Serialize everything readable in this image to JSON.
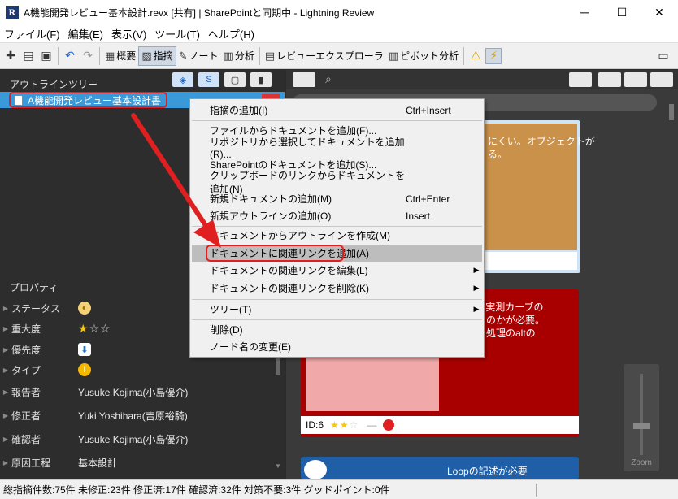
{
  "window": {
    "title": "A機能開発レビュー基本設計.revx [共有] | SharePointと同期中 - Lightning Review",
    "logo_letter": "R",
    "minimize": "─",
    "maximize": "☐",
    "close": "✕"
  },
  "menu": [
    "ファイル(F)",
    "編集(E)",
    "表示(V)",
    "ツール(T)",
    "ヘルプ(H)"
  ],
  "toolbar": {
    "overview": "概要",
    "findings": "指摘",
    "notes": "ノート",
    "analysis": "分析",
    "review_explorer": "レビューエクスプローラ",
    "pivot_analysis": "ピボット分析"
  },
  "outline": {
    "header": "アウトラインツリー",
    "root_node": "A機能開発レビュー基本設計書"
  },
  "properties": {
    "header": "プロパティ",
    "rows": [
      {
        "label": "ステータス",
        "value": ""
      },
      {
        "label": "重大度",
        "value": ""
      },
      {
        "label": "優先度",
        "value": ""
      },
      {
        "label": "タイプ",
        "value": ""
      },
      {
        "label": "報告者",
        "value": "Yusuke Kojima(小島優介)"
      },
      {
        "label": "修正者",
        "value": "Yuki Yoshihara(吉原裕騎)"
      },
      {
        "label": "確認者",
        "value": "Yusuke Kojima(小島優介)"
      },
      {
        "label": "原因工程",
        "value": "基本設計"
      }
    ],
    "severity_stars": {
      "filled": 1,
      "total": 3
    }
  },
  "context_menu": {
    "items": [
      {
        "label": "指摘の追加(I)",
        "shortcut": "Ctrl+Insert",
        "submenu": false
      },
      {
        "label": "ファイルからドキュメントを追加(F)...",
        "shortcut": "",
        "submenu": false
      },
      {
        "label": "リポジトリから選択してドキュメントを追加(R)...",
        "shortcut": "",
        "submenu": false
      },
      {
        "label": "SharePointのドキュメントを追加(S)...",
        "shortcut": "",
        "submenu": false
      },
      {
        "label": "クリップボードのリンクからドキュメントを追加(N)",
        "shortcut": "",
        "submenu": false
      },
      {
        "label": "新規ドキュメントの追加(M)",
        "shortcut": "Ctrl+Enter",
        "submenu": false
      },
      {
        "label": "新規アウトラインの追加(O)",
        "shortcut": "Insert",
        "submenu": false
      },
      {
        "label": "ドキュメントからアウトラインを作成(M)",
        "shortcut": "",
        "submenu": false
      },
      {
        "label": "ドキュメントに関連リンクを追加(A)",
        "shortcut": "",
        "submenu": false
      },
      {
        "label": "ドキュメントの関連リンクを編集(L)",
        "shortcut": "",
        "submenu": true
      },
      {
        "label": "ドキュメントの関連リンクを削除(K)",
        "shortcut": "",
        "submenu": true
      },
      {
        "label": "ツリー(T)",
        "shortcut": "",
        "submenu": true
      },
      {
        "label": "削除(D)",
        "shortcut": "",
        "submenu": false
      },
      {
        "label": "ノード名の変更(E)",
        "shortcut": "",
        "submenu": false
      }
    ],
    "submenu_glyph": "▶"
  },
  "cards": {
    "card1_text": "にくい。オブジェクトが\nる。",
    "card2_text": "カーブと実測カーブの\nどうするのかが必要。\nトを下の処理のaltの\nる",
    "card2_footer_id": "ID:6",
    "card3_text": "Loopの記述が必要"
  },
  "zoom_label": "Zoom",
  "statusbar": {
    "total": "総指摘件数:75件",
    "unfixed": "未修正:23件",
    "fixed": "修正済:17件",
    "confirmed": "確認済:32件",
    "na": "対策不要:3件",
    "goodpoint": "グッドポイント:0件"
  },
  "colors": {
    "selection_blue": "#3a9ad9",
    "annotation_red": "#e02020",
    "card_orange": "#c9914a",
    "card_red": "#a80000",
    "card_blue": "#1f5fa8"
  }
}
